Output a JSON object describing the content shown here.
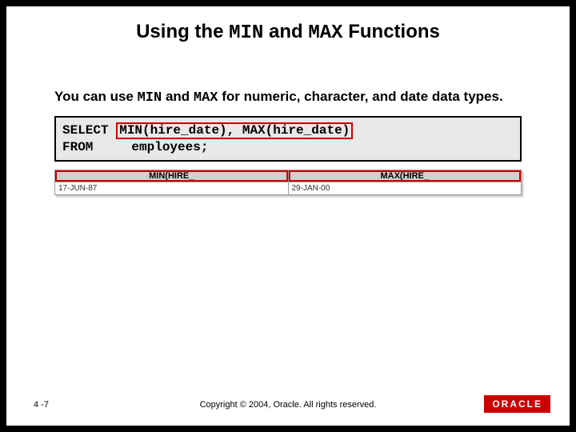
{
  "title": {
    "part1": "Using the ",
    "min": "MIN",
    "part2": " and ",
    "max": "MAX",
    "part3": " Functions"
  },
  "body": {
    "part1": "You can use ",
    "min": "MIN",
    "part2": " and ",
    "max": "MAX",
    "part3": " for numeric, character, and date data types."
  },
  "code": {
    "select_kw": "SELECT ",
    "expr": "MIN(hire_date), MAX(hire_date)",
    "line2": "FROM     employees;"
  },
  "result": {
    "headers": [
      "MIN(HIRE_",
      "MAX(HIRE_"
    ],
    "row": [
      "17-JUN-87",
      "29-JAN-00"
    ]
  },
  "footer": {
    "page": "4 -7",
    "copyright": "Copyright © 2004, Oracle.  All rights reserved.",
    "logo": "ORACLE"
  }
}
